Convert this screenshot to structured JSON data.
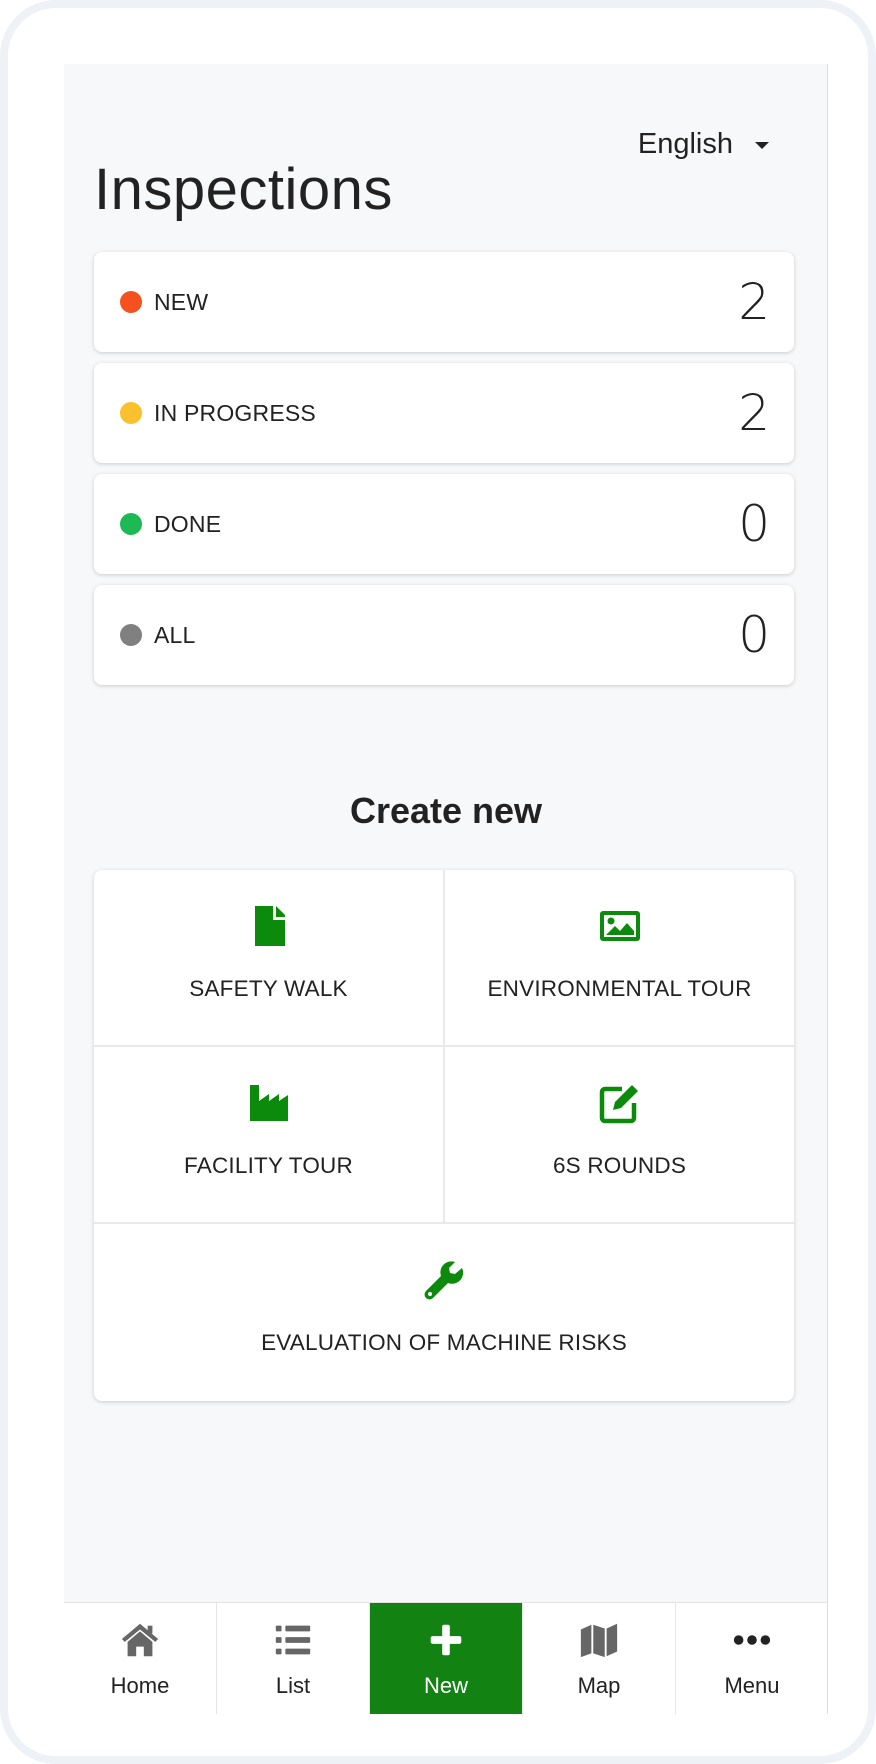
{
  "header": {
    "language": "English",
    "title": "Inspections"
  },
  "statuses": [
    {
      "label": "NEW",
      "count": "2",
      "color": "#f4511e"
    },
    {
      "label": "IN PROGRESS",
      "count": "2",
      "color": "#fbc02d"
    },
    {
      "label": "DONE",
      "count": "0",
      "color": "#1db954"
    },
    {
      "label": "ALL",
      "count": "0",
      "color": "#808080"
    }
  ],
  "create": {
    "heading": "Create new",
    "items": [
      {
        "label": "SAFETY WALK",
        "icon": "file-icon"
      },
      {
        "label": "ENVIRONMENTAL TOUR",
        "icon": "image-icon"
      },
      {
        "label": "FACILITY TOUR",
        "icon": "factory-icon"
      },
      {
        "label": "6S ROUNDS",
        "icon": "edit-icon"
      },
      {
        "label": "EVALUATION OF MACHINE RISKS",
        "icon": "wrench-icon"
      }
    ]
  },
  "nav": {
    "items": [
      {
        "label": "Home",
        "icon": "home-icon"
      },
      {
        "label": "List",
        "icon": "list-icon"
      },
      {
        "label": "New",
        "icon": "plus-icon",
        "active": true
      },
      {
        "label": "Map",
        "icon": "map-icon"
      },
      {
        "label": "Menu",
        "icon": "more-icon"
      }
    ]
  },
  "colors": {
    "accent_green": "#128212",
    "icon_green": "#0c8a0c"
  }
}
